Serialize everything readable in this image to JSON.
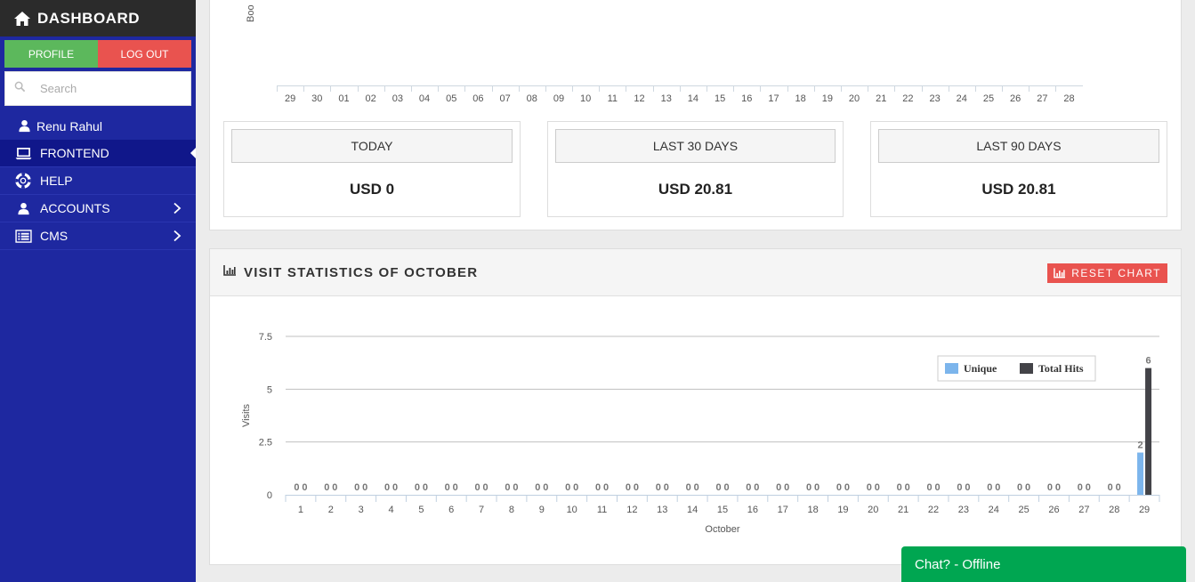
{
  "sidebar": {
    "brand": "DASHBOARD",
    "profile_label": "PROFILE",
    "logout_label": "LOG OUT",
    "search_placeholder": "Search",
    "user_name": "Renu Rahul",
    "items": [
      {
        "label": "FRONTEND",
        "icon": "laptop-icon",
        "active": true
      },
      {
        "label": "HELP",
        "icon": "lifebuoy-icon"
      },
      {
        "label": "ACCOUNTS",
        "icon": "user-icon",
        "has_children": true
      },
      {
        "label": "CMS",
        "icon": "list-icon",
        "has_children": true
      }
    ]
  },
  "booking_chart": {
    "ylabel_partial": "Boo",
    "x_ticks": [
      "29",
      "30",
      "01",
      "02",
      "03",
      "04",
      "05",
      "06",
      "07",
      "08",
      "09",
      "10",
      "11",
      "12",
      "13",
      "14",
      "15",
      "16",
      "17",
      "18",
      "19",
      "20",
      "21",
      "22",
      "23",
      "24",
      "25",
      "26",
      "27",
      "28"
    ]
  },
  "stats": [
    {
      "label": "TODAY",
      "value": "USD 0"
    },
    {
      "label": "LAST 30 DAYS",
      "value": "USD 20.81"
    },
    {
      "label": "LAST 90 DAYS",
      "value": "USD 20.81"
    }
  ],
  "visit_panel": {
    "title": "VISIT STATISTICS OF OCTOBER",
    "reset_label": "RESET CHART"
  },
  "chart_data": {
    "type": "bar",
    "xlabel": "October",
    "ylabel": "Visits",
    "ylim": [
      0,
      7.5
    ],
    "yticks": [
      0,
      2.5,
      5,
      7.5
    ],
    "categories": [
      "1",
      "2",
      "3",
      "4",
      "5",
      "6",
      "7",
      "8",
      "9",
      "10",
      "11",
      "12",
      "13",
      "14",
      "15",
      "16",
      "17",
      "18",
      "19",
      "20",
      "21",
      "22",
      "23",
      "24",
      "25",
      "26",
      "27",
      "28",
      "29"
    ],
    "series": [
      {
        "name": "Unique",
        "color": "#7cb5ec",
        "values": [
          0,
          0,
          0,
          0,
          0,
          0,
          0,
          0,
          0,
          0,
          0,
          0,
          0,
          0,
          0,
          0,
          0,
          0,
          0,
          0,
          0,
          0,
          0,
          0,
          0,
          0,
          0,
          0,
          2
        ]
      },
      {
        "name": "Total Hits",
        "color": "#434348",
        "values": [
          0,
          0,
          0,
          0,
          0,
          0,
          0,
          0,
          0,
          0,
          0,
          0,
          0,
          0,
          0,
          0,
          0,
          0,
          0,
          0,
          0,
          0,
          0,
          0,
          0,
          0,
          0,
          0,
          6
        ]
      }
    ],
    "legend_position": "top-right",
    "grid": true
  },
  "chat": {
    "label": "Chat? - Offline"
  }
}
